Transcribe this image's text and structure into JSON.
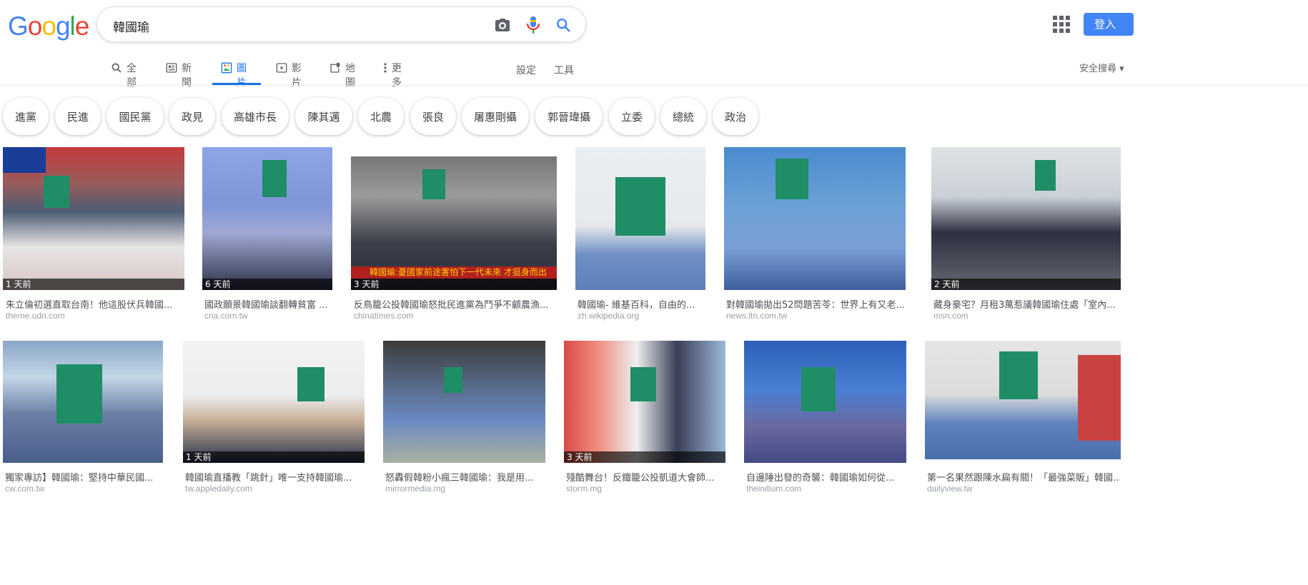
{
  "logo": {
    "letters": [
      "G",
      "o",
      "o",
      "g",
      "l",
      "e"
    ]
  },
  "search": {
    "query": "韓國瑜"
  },
  "header": {
    "signin_label": "登入"
  },
  "tabs": [
    {
      "label": "全部",
      "icon": "search-icon"
    },
    {
      "label": "新聞",
      "icon": "news-icon"
    },
    {
      "label": "圖片",
      "icon": "image-icon",
      "active": true
    },
    {
      "label": "影片",
      "icon": "video-icon"
    },
    {
      "label": "地圖",
      "icon": "map-icon"
    },
    {
      "label": "更多",
      "icon": "more-vert-icon"
    }
  ],
  "tools": {
    "settings": "設定",
    "tools": "工具",
    "safe_search": "安全搜尋"
  },
  "chips": [
    "進黨",
    "民進",
    "國民黨",
    "政見",
    "高雄市長",
    "陳其邁",
    "北農",
    "張良",
    "屠惠剛攝",
    "郭晉瑋攝",
    "立委",
    "總統",
    "政治"
  ],
  "results": [
    {
      "title": "朱立倫初選直取台南！他這股伏兵韓國...",
      "source": "theme.udn.com",
      "time": "1 天前"
    },
    {
      "title": "國政願景韓國瑜談翻轉貧富 ...",
      "source": "cna.com.tw",
      "time": "6 天前"
    },
    {
      "title": "反鳥籠公投韓國瑜怒批民進黨為鬥爭不顧農漁...",
      "source": "chinatimes.com",
      "time": "3 天前",
      "overlay": "韓國瑜:憂國家前途害怕下一代未來 才挺身而出"
    },
    {
      "title": "韓國瑜- 維基百科，自由的...",
      "source": "zh.wikipedia.org",
      "time": ""
    },
    {
      "title": "對韓國瑜拋出52問題苦苓：世界上有又老...",
      "source": "news.ltn.com.tw",
      "time": ""
    },
    {
      "title": "藏身豪宅？月租3萬惹議韓國瑜住處「室內...",
      "source": "msn.com",
      "time": "2 天前"
    },
    {
      "title": "獨家專訪】韓國瑜：堅持中華民國...",
      "source": "cw.com.tw",
      "time": ""
    },
    {
      "title": "韓國瑜直播教「跳針」唯一支持韓國瑜...",
      "source": "tw.appledaily.com",
      "time": "1 天前"
    },
    {
      "title": "怒轟假韓粉小瘋三韓國瑜：我是用...",
      "source": "mirrormedia.mg",
      "time": ""
    },
    {
      "title": "殘酷舞台！反鐵籠公投凱道大會師...",
      "source": "storm.mg",
      "time": "3 天前"
    },
    {
      "title": "自邊陲出發的奇襲：韓國瑜如何從...",
      "source": "theinitium.com",
      "time": ""
    },
    {
      "title": "第一名果然跟陳水扁有關！「最強菜販」韓國...",
      "source": "dailyview.tw",
      "time": ""
    }
  ],
  "colors": {
    "accent": "#1a73e8",
    "signin": "#4285f4",
    "face_mask": "#1f8d66"
  }
}
